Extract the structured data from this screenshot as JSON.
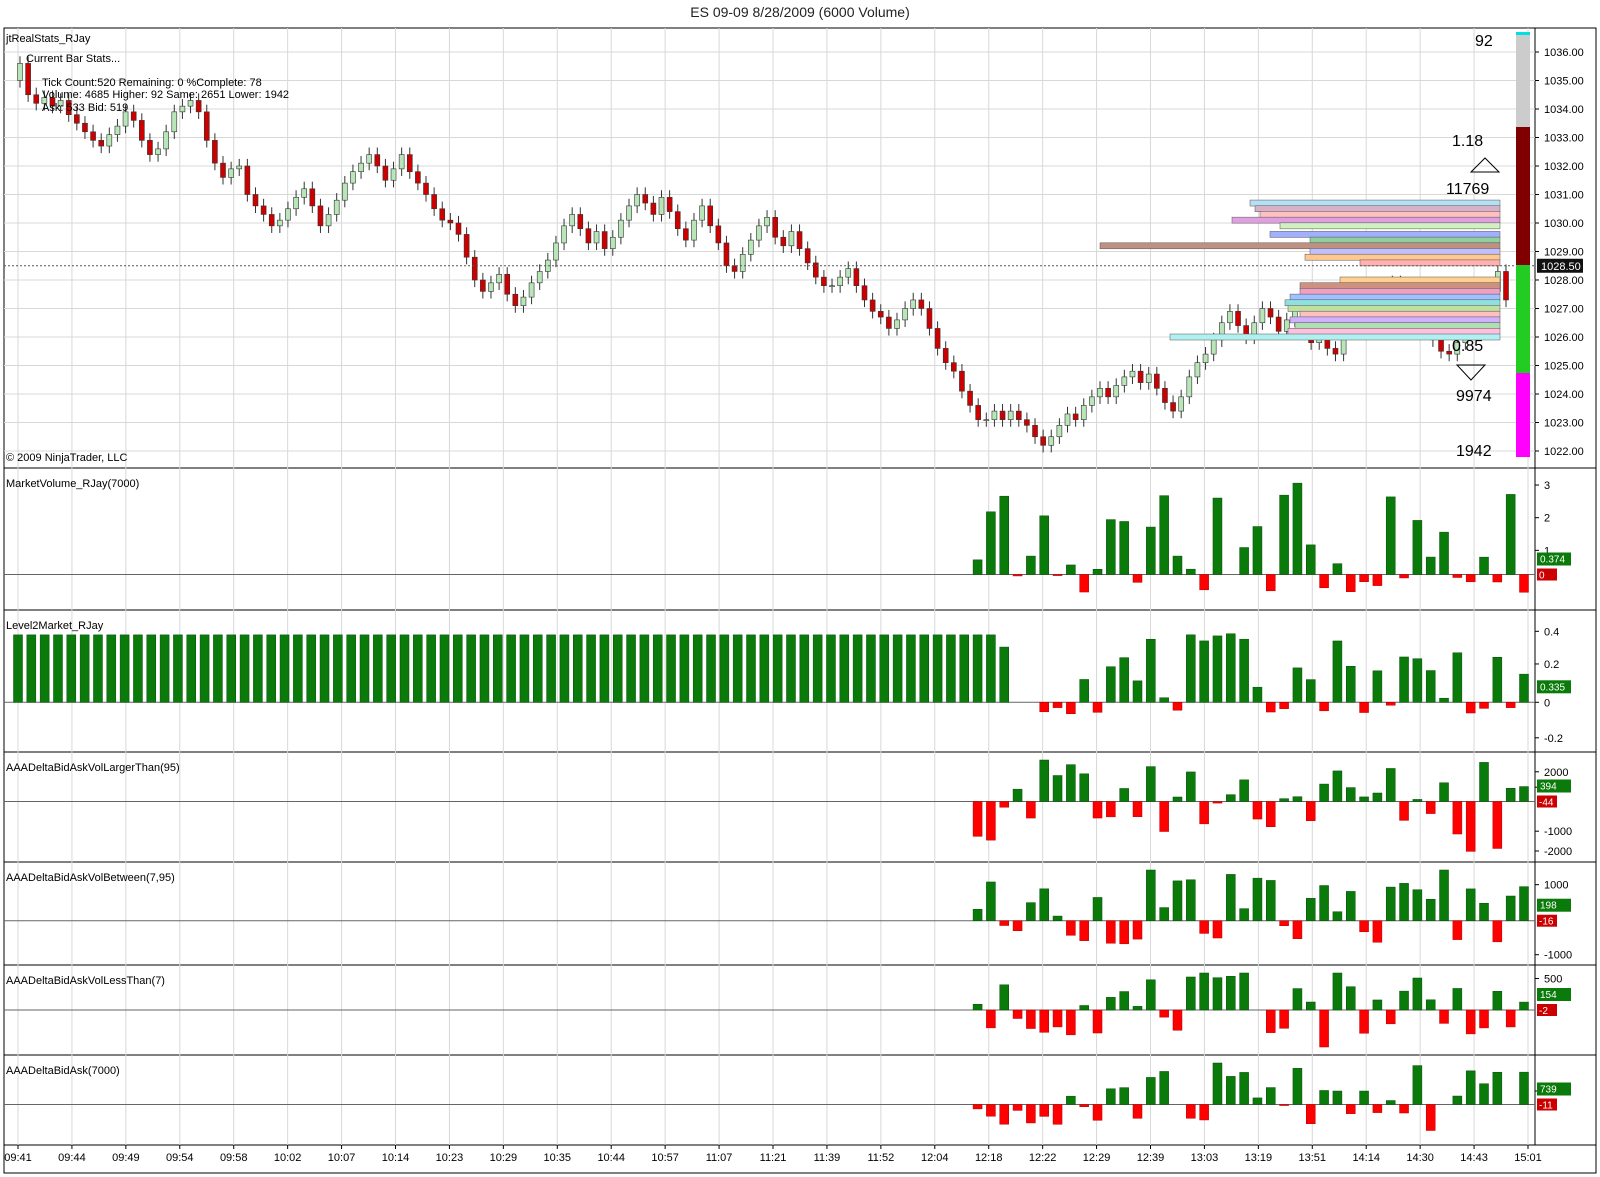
{
  "title": "ES 09-09  8/28/2009 (6000 Volume)",
  "copyright": "© 2009 NinjaTrader, LLC",
  "stats": {
    "name": "jtRealStats_RJay",
    "header": "Current Bar Stats...",
    "line1": "Tick Count:520   Remaining: 0   %Complete: 78",
    "line2": "Volume: 4685   Higher: 92   Same: 2651   Lower: 1942",
    "line3": "Ask: 533   Bid: 519"
  },
  "annotations": {
    "top_count": "92",
    "ratio_up": "1.18",
    "vol_up": "11769",
    "ratio_down": "0.85",
    "vol_down": "9974",
    "bottom_count": "1942",
    "last_price": "1028.50"
  },
  "price_ticks": [
    "1036.00",
    "1035.00",
    "1034.00",
    "1033.00",
    "1032.00",
    "1031.00",
    "1030.00",
    "1029.00",
    "1028.00",
    "1027.00",
    "1026.00",
    "1025.00",
    "1024.00",
    "1023.00",
    "1022.00"
  ],
  "time_ticks": [
    "09:41",
    "09:44",
    "09:49",
    "09:54",
    "09:58",
    "10:02",
    "10:07",
    "10:14",
    "10:23",
    "10:29",
    "10:35",
    "10:44",
    "10:57",
    "11:07",
    "11:21",
    "11:39",
    "11:52",
    "12:04",
    "12:18",
    "12:22",
    "12:29",
    "12:39",
    "13:03",
    "13:19",
    "13:51",
    "14:14",
    "14:30",
    "14:43",
    "15:01"
  ],
  "panels": [
    {
      "name": "MarketVolume_RJay(7000)",
      "ticks": [
        "3",
        "2",
        "1"
      ],
      "pos_label": "0.374",
      "neg_label": "0"
    },
    {
      "name": "Level2Market_RJay",
      "ticks": [
        "0.4",
        "0.2",
        "0",
        "-0.2"
      ],
      "pos_label": "0.335",
      "neg_label": ""
    },
    {
      "name": "AAADeltaBidAskVolLargerThan(95)",
      "ticks": [
        "2000",
        "1000",
        "-1000",
        "-2000"
      ],
      "pos_label": "394",
      "neg_label": "-44"
    },
    {
      "name": "AAADeltaBidAskVolBetween(7,95)",
      "ticks": [
        "1000",
        "-1000"
      ],
      "pos_label": "198",
      "neg_label": "-16"
    },
    {
      "name": "AAADeltaBidAskVolLessThan(7)",
      "ticks": [
        "500"
      ],
      "pos_label": "154",
      "neg_label": "-2"
    },
    {
      "name": "AAADeltaBidAsk(7000)",
      "ticks": [
        "739"
      ],
      "pos_label": "739",
      "neg_label": "-11"
    }
  ],
  "colors": {
    "up": "#b8e6b8",
    "down": "#cc0000",
    "bar_pos": "#0a7a0a",
    "bar_neg": "#ff0000",
    "grid": "#d8d8d8"
  },
  "chart_data": {
    "type": "candlestick",
    "title": "ES 09-09  8/28/2009 (6000 Volume)",
    "ylim": [
      1021.8,
      1036.2
    ],
    "closes": [
      1035.6,
      1034.5,
      1034.2,
      1034.4,
      1034.1,
      1034.3,
      1033.8,
      1033.5,
      1033.2,
      1032.9,
      1032.7,
      1033.1,
      1033.4,
      1033.9,
      1033.6,
      1032.9,
      1032.4,
      1032.6,
      1033.2,
      1033.9,
      1034.1,
      1034.3,
      1033.9,
      1032.9,
      1032.1,
      1031.6,
      1031.9,
      1032.0,
      1031.0,
      1030.6,
      1030.3,
      1029.9,
      1030.1,
      1030.5,
      1030.9,
      1031.2,
      1030.6,
      1029.9,
      1030.3,
      1030.8,
      1031.4,
      1031.8,
      1032.1,
      1032.4,
      1032.0,
      1031.5,
      1031.9,
      1032.4,
      1031.8,
      1031.4,
      1031.0,
      1030.5,
      1030.1,
      1030.0,
      1029.6,
      1028.8,
      1028.0,
      1027.6,
      1027.9,
      1028.2,
      1027.5,
      1027.1,
      1027.4,
      1027.9,
      1028.3,
      1028.7,
      1029.3,
      1029.9,
      1030.3,
      1029.8,
      1029.3,
      1029.7,
      1029.1,
      1029.5,
      1030.1,
      1030.6,
      1031.0,
      1030.7,
      1030.3,
      1030.9,
      1030.4,
      1029.8,
      1029.4,
      1030.1,
      1030.6,
      1029.9,
      1029.3,
      1028.5,
      1028.3,
      1028.9,
      1029.4,
      1029.9,
      1030.2,
      1029.5,
      1029.2,
      1029.7,
      1029.1,
      1028.6,
      1028.1,
      1027.8,
      1027.8,
      1028.1,
      1028.4,
      1027.8,
      1027.3,
      1026.9,
      1026.7,
      1026.3,
      1026.6,
      1027.0,
      1027.3,
      1027.0,
      1026.3,
      1025.6,
      1025.1,
      1024.8,
      1024.1,
      1023.6,
      1023.1,
      1023.1,
      1023.4,
      1023.1,
      1023.4,
      1023.1,
      1022.9,
      1022.5,
      1022.2,
      1022.5,
      1022.9,
      1023.3,
      1023.1,
      1023.6,
      1023.9,
      1024.2,
      1023.9,
      1024.3,
      1024.6,
      1024.8,
      1024.4,
      1024.7,
      1024.2,
      1023.7,
      1023.4,
      1023.9,
      1024.6,
      1025.1,
      1025.4,
      1025.9,
      1026.5,
      1026.9,
      1026.4,
      1026.0,
      1026.5,
      1027.0,
      1026.7,
      1026.2,
      1026.6,
      1027.0,
      1026.4,
      1025.8,
      1026.1,
      1025.6,
      1025.4,
      1026.2,
      1026.9,
      1027.3,
      1027.6,
      1027.8,
      1027.5,
      1027.9,
      1027.6,
      1027.2,
      1026.8,
      1026.4,
      1025.9,
      1025.5,
      1025.4,
      1025.8,
      1026.2,
      1026.7,
      1027.1,
      1027.6,
      1028.3,
      1027.3
    ]
  }
}
